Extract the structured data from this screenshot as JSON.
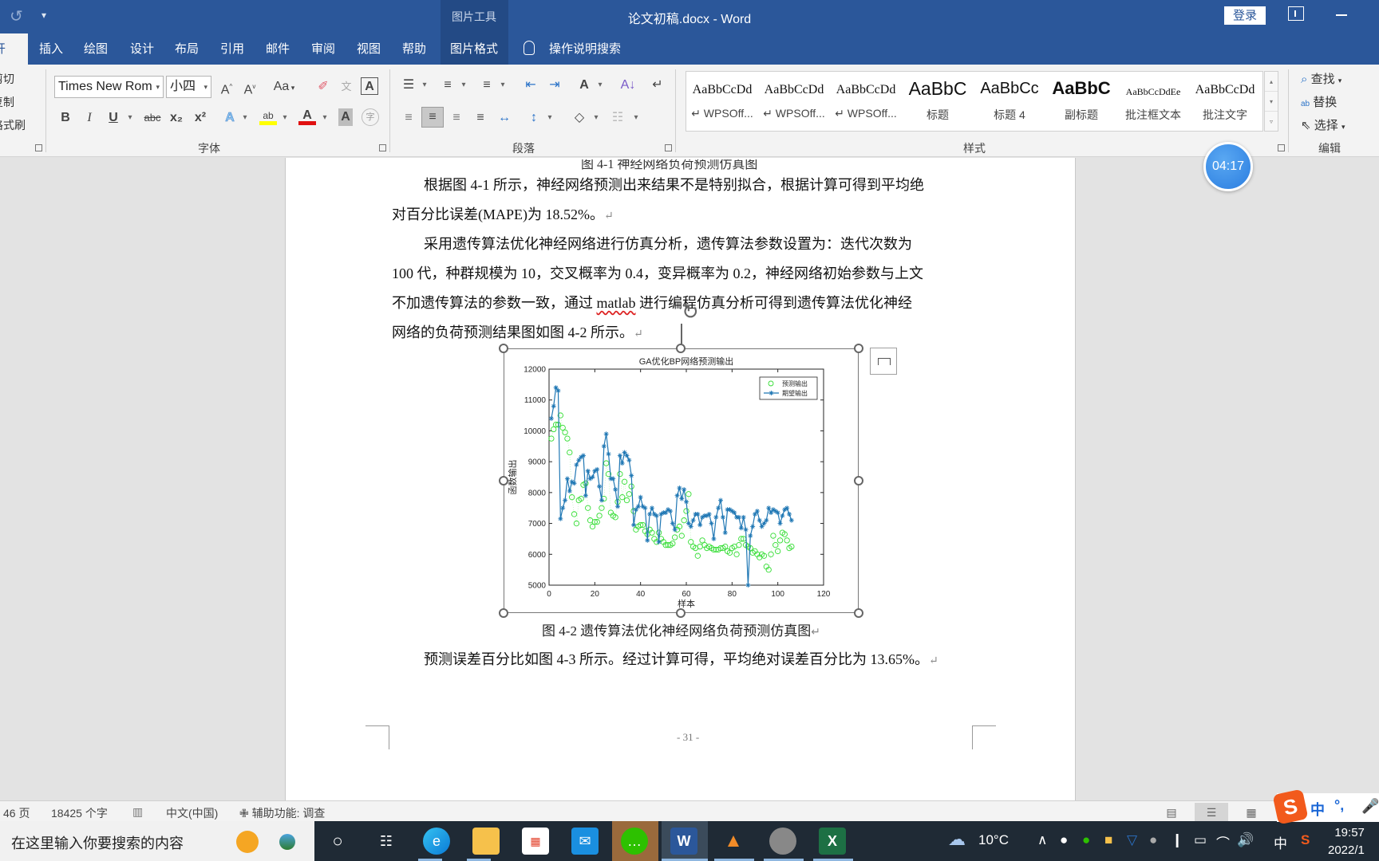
{
  "titlebar": {
    "undo_icon": "undo-icon",
    "qat_icon": "customize-qat-icon",
    "context_tab_group": "图片工具",
    "doc_title": "论文初稿.docx  -  Word",
    "login_label": "登录",
    "ribbon_display_icon": "ribbon-display-options-icon",
    "minimize_icon": "minimize-icon"
  },
  "tabs": [
    {
      "label": "开始",
      "active": true
    },
    {
      "label": "插入"
    },
    {
      "label": "绘图"
    },
    {
      "label": "设计"
    },
    {
      "label": "布局"
    },
    {
      "label": "引用"
    },
    {
      "label": "邮件"
    },
    {
      "label": "审阅"
    },
    {
      "label": "视图"
    },
    {
      "label": "帮助"
    },
    {
      "label": "图片格式",
      "context": true
    }
  ],
  "tell_me": {
    "icon": "lightbulb-icon",
    "label": "操作说明搜索"
  },
  "clipboard": {
    "cut": "剪切",
    "copy": "复制",
    "format_painter": "格式刷"
  },
  "font_group": {
    "label": "字体",
    "font_name": "Times New Rom",
    "font_size": "小四",
    "grow": "Aˆ",
    "shrink": "Aˇ",
    "change_case": "Aa",
    "clear_format_icon": "eraser-icon",
    "phonetic": "文",
    "char_border": "A",
    "bold": "B",
    "italic": "I",
    "underline": "U",
    "strike": "abc",
    "subscript": "x₂",
    "superscript": "x²",
    "text_effects": "A",
    "highlight": "ab",
    "font_color": "A",
    "char_shading": "A",
    "enclose": "字",
    "highlight_color": "#ffff00",
    "font_color_value": "#e01010"
  },
  "paragraph_group": {
    "label": "段落",
    "bullets": "☰",
    "numbering": "≡",
    "multilevel": "≡",
    "decrease_indent": "⇤",
    "increase_indent": "⇥",
    "direction": "A",
    "sort": "A↓",
    "show_marks": "↵",
    "align_left": "≡",
    "align_center": "≡",
    "align_right": "≡",
    "justify": "≡",
    "distributed": "↔",
    "line_spacing": "↕",
    "shading": "◇",
    "borders": "☷"
  },
  "styles_group": {
    "label": "样式",
    "items": [
      {
        "preview": "AaBbCcDd",
        "name": "↵ WPSOff..."
      },
      {
        "preview": "AaBbCcDd",
        "name": "↵ WPSOff..."
      },
      {
        "preview": "AaBbCcDd",
        "name": "↵ WPSOff..."
      },
      {
        "preview": "AaBbC",
        "name": "标题"
      },
      {
        "preview": "AaBbCc",
        "name": "标题 4"
      },
      {
        "preview": "AaBbC",
        "name": "副标题"
      },
      {
        "preview": "AaBbCcDdEe",
        "name": "批注框文本"
      },
      {
        "preview": "AaBbCcDd",
        "name": "批注文字"
      }
    ]
  },
  "editing_group": {
    "label": "编辑",
    "find": "查找",
    "replace": "替换",
    "select": "选择"
  },
  "timer": "04:17",
  "document": {
    "paragraphs": [
      "根据图 4-1 所示，神经网络预测出来结果不是特别拟合，根据计算可得到平均绝",
      "对百分比误差(MAPE)为 18.52%。",
      "采用遗传算法优化神经网络进行仿真分析，遗传算法参数设置为：迭代次数为",
      "100 代，种群规模为 10，交叉概率为 0.4，变异概率为 0.2，神经网络初始参数与上文",
      "不加遗传算法的参数一致，通过 ",
      "matlab",
      " 进行编程仿真分析可得到遗传算法优化神经",
      "网络的负荷预测结果图如图 4-2 所示。"
    ],
    "caption": "图 4-2  遗传算法优化神经网络负荷预测仿真图",
    "after_caption": "预测误差百分比如图 4-3 所示。经过计算可得，平均绝对误差百分比为 13.65%。",
    "page_number": "- 31 -",
    "para_mark": "↵"
  },
  "chart_data": {
    "type": "line",
    "title": "GA优化BP网络预测输出",
    "xlabel": "样本",
    "ylabel": "函数输出",
    "xlim": [
      0,
      120
    ],
    "ylim": [
      5000,
      12000
    ],
    "xticks": [
      0,
      20,
      40,
      60,
      80,
      100,
      120
    ],
    "yticks": [
      5000,
      6000,
      7000,
      8000,
      9000,
      10000,
      11000,
      12000
    ],
    "legend_position": "top-right",
    "series": [
      {
        "name": "预测输出",
        "marker": "circle",
        "color": "#33dd33",
        "x": [
          1,
          2,
          3,
          4,
          5,
          6,
          7,
          8,
          9,
          10,
          11,
          12,
          13,
          14,
          15,
          16,
          17,
          18,
          19,
          20,
          21,
          22,
          23,
          24,
          25,
          26,
          27,
          28,
          29,
          30,
          31,
          32,
          33,
          34,
          35,
          36,
          37,
          38,
          39,
          40,
          41,
          42,
          43,
          44,
          45,
          46,
          47,
          48,
          49,
          50,
          51,
          52,
          53,
          54,
          55,
          56,
          57,
          58,
          59,
          60,
          61,
          62,
          63,
          64,
          65,
          66,
          67,
          68,
          69,
          70,
          71,
          72,
          73,
          74,
          75,
          76,
          77,
          78,
          79,
          80,
          81,
          82,
          83,
          84,
          85,
          86,
          87,
          88,
          89,
          90,
          91,
          92,
          93,
          94,
          95,
          96,
          97,
          98,
          99,
          100,
          101,
          102,
          103,
          104,
          105,
          106
        ],
        "values": [
          9750,
          10050,
          10200,
          10200,
          10500,
          10100,
          9950,
          9750,
          9300,
          7850,
          7300,
          7000,
          7750,
          7800,
          8250,
          8300,
          7500,
          7100,
          6900,
          7050,
          7050,
          7250,
          7500,
          7800,
          8950,
          8600,
          7350,
          7250,
          7200,
          7700,
          8600,
          7850,
          8350,
          7750,
          7950,
          8200,
          7400,
          6800,
          6900,
          6950,
          6950,
          6750,
          6650,
          6800,
          6700,
          6500,
          6400,
          6700,
          6500,
          6400,
          6300,
          6300,
          6300,
          6350,
          6550,
          6800,
          6900,
          6600,
          7100,
          7400,
          7950,
          6400,
          6250,
          6200,
          5950,
          6250,
          6450,
          6300,
          6200,
          6250,
          6200,
          6150,
          6150,
          6150,
          6200,
          6200,
          6250,
          6100,
          6050,
          6200,
          6250,
          6000,
          6300,
          6500,
          6500,
          6300,
          6250,
          6200,
          6050,
          6100,
          6000,
          5900,
          6000,
          5950,
          5600,
          5500,
          6000,
          6600,
          6300,
          6100,
          6450,
          6700,
          6650,
          6450,
          6200,
          6250
        ]
      },
      {
        "name": "期望输出",
        "marker": "asterisk",
        "color": "#1f77b4",
        "x": [
          1,
          2,
          3,
          4,
          5,
          6,
          7,
          8,
          9,
          10,
          11,
          12,
          13,
          14,
          15,
          16,
          17,
          18,
          19,
          20,
          21,
          22,
          23,
          24,
          25,
          26,
          27,
          28,
          29,
          30,
          31,
          32,
          33,
          34,
          35,
          36,
          37,
          38,
          39,
          40,
          41,
          42,
          43,
          44,
          45,
          46,
          47,
          48,
          49,
          50,
          51,
          52,
          53,
          54,
          55,
          56,
          57,
          58,
          59,
          60,
          61,
          62,
          63,
          64,
          65,
          66,
          67,
          68,
          69,
          70,
          71,
          72,
          73,
          74,
          75,
          76,
          77,
          78,
          79,
          80,
          81,
          82,
          83,
          84,
          85,
          86,
          87,
          88,
          89,
          90,
          91,
          92,
          93,
          94,
          95,
          96,
          97,
          98,
          99,
          100,
          101,
          102,
          103,
          104,
          105,
          106
        ],
        "values": [
          10400,
          10800,
          11400,
          11300,
          7150,
          7500,
          7750,
          8450,
          8050,
          8350,
          8300,
          8900,
          9050,
          9150,
          9200,
          7900,
          8700,
          8450,
          8500,
          8700,
          8750,
          8200,
          7750,
          9500,
          9900,
          9250,
          8450,
          8450,
          8100,
          7550,
          9200,
          8950,
          9300,
          9200,
          9050,
          8550,
          6950,
          7450,
          7550,
          7850,
          7550,
          7500,
          6450,
          7300,
          7500,
          7300,
          7250,
          6400,
          7300,
          7350,
          7350,
          7450,
          7400,
          7000,
          6800,
          7900,
          8150,
          7800,
          8100,
          7700,
          7000,
          6900,
          7100,
          7300,
          7300,
          6950,
          7200,
          7250,
          7250,
          7300,
          7000,
          6500,
          7200,
          7500,
          7750,
          7200,
          6700,
          7450,
          7450,
          7400,
          7350,
          7200,
          7200,
          6850,
          7200,
          6800,
          5000,
          6600,
          6900,
          7300,
          7400,
          7100,
          6900,
          7000,
          7100,
          7500,
          7350,
          7450,
          7400,
          7350,
          7000,
          7250,
          7450,
          7500,
          7300,
          7100
        ]
      }
    ]
  },
  "statusbar": {
    "pages": "46 页",
    "words": "18425 个字",
    "proofing_icon": "proofing-icon",
    "language": "中文(中国)",
    "accessibility": "辅助功能: 调查",
    "view_read_icon": "read-mode-icon",
    "view_print_icon": "print-layout-icon",
    "view_web_icon": "web-layout-icon"
  },
  "ime": {
    "logo": "S",
    "mode": "中",
    "punct": "°,",
    "mic_icon": "microphone-icon"
  },
  "taskbar": {
    "search_placeholder": "在这里输入你要搜索的内容",
    "apps": [
      "cortana",
      "task-view",
      "edge",
      "file-explorer",
      "store",
      "mail",
      "wechat",
      "word",
      "matlab",
      "avatar-app",
      "excel"
    ],
    "weather": "10°C",
    "tray_ime": "中",
    "time": "19:57",
    "date": "2022/1"
  }
}
